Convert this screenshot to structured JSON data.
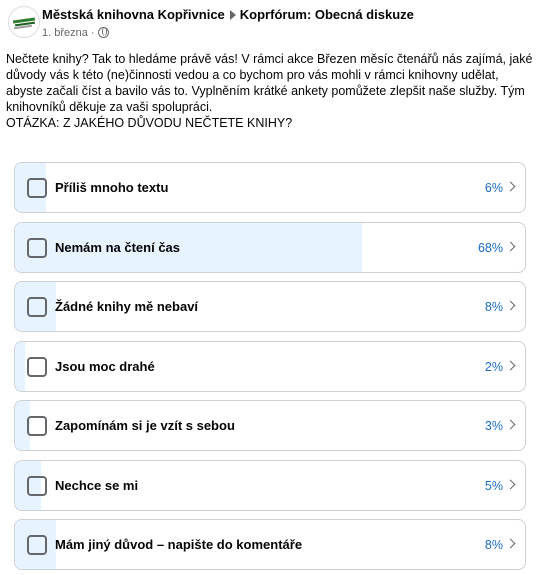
{
  "post": {
    "group_name": "Městská knihovna Kopřivnice",
    "forum_name": "Koprfórum: Obecná diskuze",
    "date": "1. března",
    "separator": "·",
    "text_lines": [
      "Nečtete knihy? Tak to hledáme právě vás! V rámci akce  Březen měsíc čtenářů nás zajímá, jaké",
      "důvody vás k této (ne)činnosti  vedou a co bychom pro vás mohli v rámci knihovny udělat,",
      "abyste začali  číst a bavilo vás to. Vyplněním krátké ankety pomůžete zlepšit naše  služby. Tým",
      "knihovníků děkuje za vaši spolupráci.",
      "OTÁZKA: Z JAKÉHO DŮVODU NEČTETE KNIHY?"
    ]
  },
  "colors": {
    "accent": "#1b6ec2",
    "fill": "#e7f3ff",
    "border": "#ced0d4",
    "muted": "#65676b"
  },
  "poll": {
    "options": [
      {
        "label": "Příliš mnoho textu",
        "percent": "6%",
        "value": 0.06
      },
      {
        "label": "Nemám na čtení čas",
        "percent": "68%",
        "value": 0.68
      },
      {
        "label": "Žádné knihy mě nebaví",
        "percent": "8%",
        "value": 0.08
      },
      {
        "label": "Jsou moc drahé",
        "percent": "2%",
        "value": 0.02
      },
      {
        "label": "Zapomínám si je vzít s sebou",
        "percent": "3%",
        "value": 0.03
      },
      {
        "label": "Nechce se mi",
        "percent": "5%",
        "value": 0.05
      },
      {
        "label": "Mám jiný důvod – napište do komentáře",
        "percent": "8%",
        "value": 0.08
      }
    ]
  }
}
